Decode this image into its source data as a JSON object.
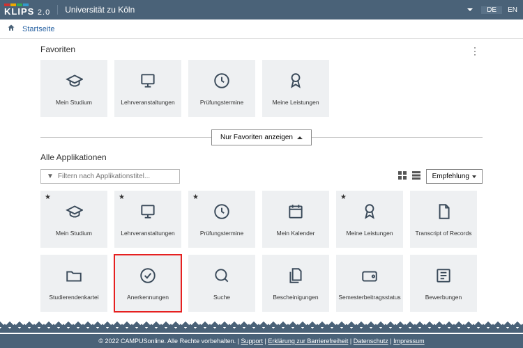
{
  "header": {
    "logo": "KLIPS",
    "version": "2.0",
    "university": "Universität zu Köln",
    "lang_de": "DE",
    "lang_en": "EN"
  },
  "breadcrumb": {
    "home": "Startseite"
  },
  "favorites": {
    "title": "Favoriten",
    "tiles": [
      {
        "label": "Mein Studium",
        "icon": "graduation"
      },
      {
        "label": "Lehrveranstaltungen",
        "icon": "presentation"
      },
      {
        "label": "Prüfungstermine",
        "icon": "clock"
      },
      {
        "label": "Meine Leistungen",
        "icon": "badge"
      }
    ]
  },
  "toggle": {
    "label": "Nur Favoriten anzeigen"
  },
  "all": {
    "title": "Alle Applikationen",
    "search_placeholder": "Filtern nach Applikationstitel...",
    "sort_label": "Empfehlung",
    "tiles": [
      {
        "label": "Mein Studium",
        "icon": "graduation",
        "fav": true
      },
      {
        "label": "Lehrveranstaltungen",
        "icon": "presentation",
        "fav": true
      },
      {
        "label": "Prüfungstermine",
        "icon": "clock",
        "fav": true
      },
      {
        "label": "Mein Kalender",
        "icon": "calendar",
        "fav": false
      },
      {
        "label": "Meine Leistungen",
        "icon": "badge",
        "fav": true
      },
      {
        "label": "Transcript of Records",
        "icon": "document",
        "fav": false
      },
      {
        "label": "Studierendenkartei",
        "icon": "folder",
        "fav": false
      },
      {
        "label": "Anerkennungen",
        "icon": "check",
        "fav": false,
        "highlighted": true
      },
      {
        "label": "Suche",
        "icon": "search",
        "fav": false
      },
      {
        "label": "Bescheinigungen",
        "icon": "files",
        "fav": false
      },
      {
        "label": "Semesterbeitragsstatus",
        "icon": "wallet",
        "fav": false
      },
      {
        "label": "Bewerbungen",
        "icon": "news",
        "fav": false
      }
    ]
  },
  "footer": {
    "copyright": "© 2022 CAMPUSonline. Alle Rechte vorbehalten.",
    "links": [
      "Support",
      "Erklärung zur Barrierefreiheit",
      "Datenschutz",
      "Impressum"
    ]
  },
  "icons": {
    "graduation": "<path d='M3 10l10-5 10 5-10 5z'/><path d='M7 12v4c0 1 3 3 6 3s6-2 6-3v-4'/>",
    "presentation": "<rect x='4' y='4' width='16' height='12' rx='1'/><path d='M12 16v4M8 20h8'/>",
    "clock": "<circle cx='12' cy='12' r='9'/><path d='M12 7v5l3 2'/>",
    "badge": "<circle cx='12' cy='8' r='5'/><path d='M9 12l-2 8 5-3 5 3-2-8'/>",
    "calendar": "<rect x='4' y='5' width='16' height='15' rx='1'/><path d='M4 9h16M8 3v4M16 3v4'/>",
    "document": "<path d='M7 3h8l4 4v14H7z'/><path d='M15 3v4h4'/>",
    "folder": "<path d='M3 7h6l2 2h10v10H3z'/>",
    "check": "<circle cx='12' cy='12' r='9'/><path d='M8 12l3 3 5-6'/>",
    "search": "<circle cx='11' cy='11' r='7'/><path d='M20 20l-4-4'/>",
    "files": "<path d='M8 3h8l3 3v12H8z'/><path d='M5 7v14h11'/>",
    "wallet": "<rect x='3' y='7' width='18' height='12' rx='2'/><circle cx='17' cy='13' r='1.5'/>",
    "news": "<rect x='4' y='4' width='16' height='16' rx='1'/><path d='M8 8h8M8 12h8M8 16h5'/>"
  }
}
